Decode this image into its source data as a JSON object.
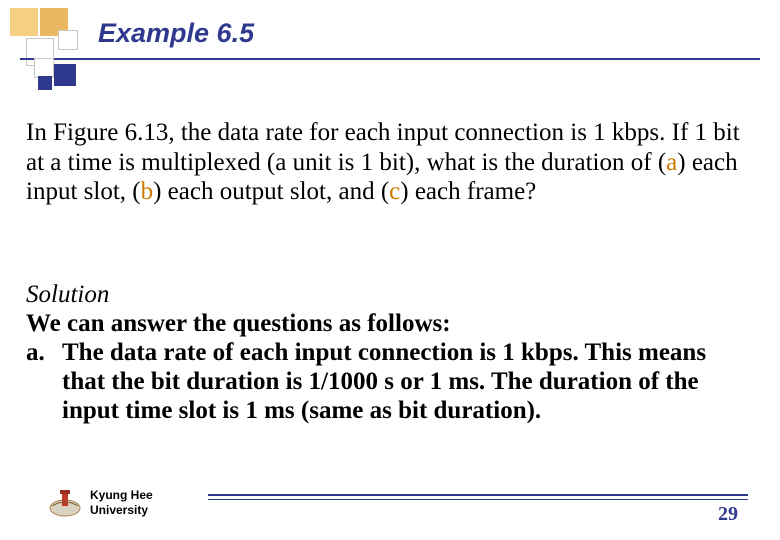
{
  "title": "Example 6.5",
  "question": {
    "pre_a": "In Figure 6.13, the data rate for each input connection is 1 kbps. If 1 bit at a time is multiplexed (a unit is 1 bit), what is the duration of (",
    "a": "a",
    "mid_ab": ") each input slot, (",
    "b": "b",
    "mid_bc": ") each output slot, and (",
    "c": "c",
    "post_c": ") each frame?"
  },
  "solution": {
    "heading": "Solution",
    "intro": "We can answer the questions as follows:",
    "item_a_marker": "a.",
    "item_a_body": "The data rate of each input connection is 1 kbps. This means that the bit duration is 1/1000 s or 1 ms. The duration of the input time slot is 1 ms (same as bit duration)."
  },
  "footer": {
    "uni_line1": "Kyung Hee",
    "uni_line2": "University",
    "page_no": "29"
  }
}
